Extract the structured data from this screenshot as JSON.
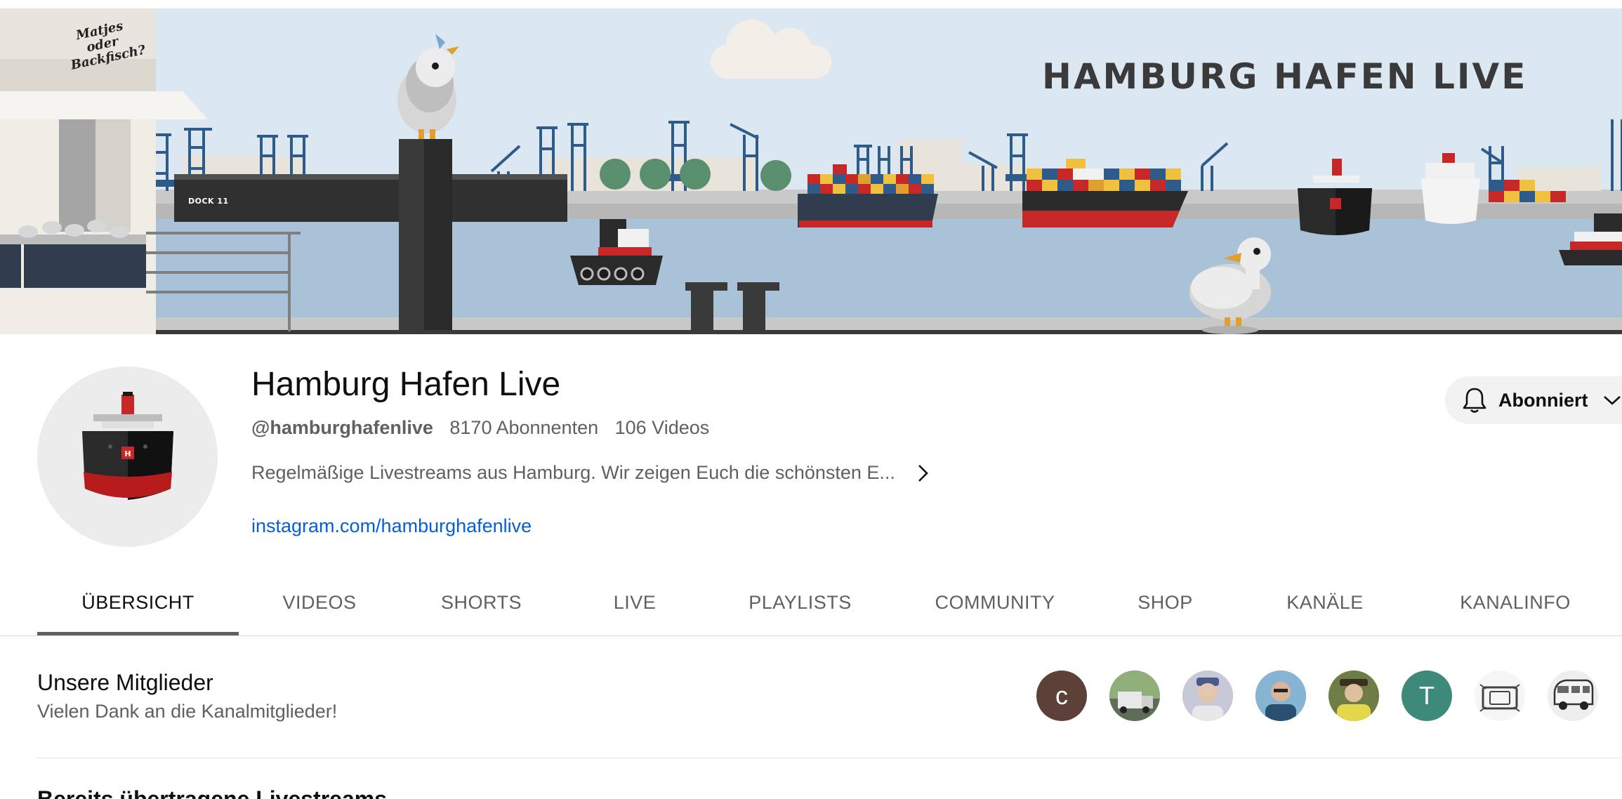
{
  "banner": {
    "title": "HAMBURG HAFEN LIVE",
    "stall_sign": "Matjes oder Backfisch?",
    "dock_label": "DOCK 11"
  },
  "channel": {
    "name": "Hamburg Hafen Live",
    "handle": "@hamburghafenlive",
    "subscribers": "8170 Abonnenten",
    "videos": "106 Videos",
    "description": "Regelmäßige Livestreams aus Hamburg. Wir zeigen Euch die schönsten E...",
    "link": "instagram.com/hamburghafenlive",
    "subscribe_label": "Abonniert"
  },
  "tabs": [
    {
      "label": "ÜBERSICHT",
      "active": true
    },
    {
      "label": "VIDEOS"
    },
    {
      "label": "SHORTS"
    },
    {
      "label": "LIVE"
    },
    {
      "label": "PLAYLISTS"
    },
    {
      "label": "COMMUNITY"
    },
    {
      "label": "SHOP"
    },
    {
      "label": "KANÄLE"
    },
    {
      "label": "KANALINFO"
    }
  ],
  "members": {
    "title": "Unsere Mitglieder",
    "subtitle": "Vielen Dank an die Kanalmitglieder!",
    "avatars": [
      {
        "letter": "c",
        "color": "#5d4037"
      },
      {
        "letter": "",
        "color": "#6f8a5a"
      },
      {
        "letter": "",
        "color": "#b6b8c6"
      },
      {
        "letter": "",
        "color": "#4a86a8"
      },
      {
        "letter": "",
        "color": "#b0a646"
      },
      {
        "letter": "T",
        "color": "#3d8a7a"
      },
      {
        "letter": "",
        "color": "#f4f4f4"
      },
      {
        "letter": "",
        "color": "#e6e6e6"
      }
    ]
  },
  "next_section": {
    "title": "Bereits übertragene Livestreams"
  },
  "icons": {
    "chevron": "chevron-right-icon",
    "bell": "bell-icon",
    "caret": "chevron-down-icon"
  }
}
